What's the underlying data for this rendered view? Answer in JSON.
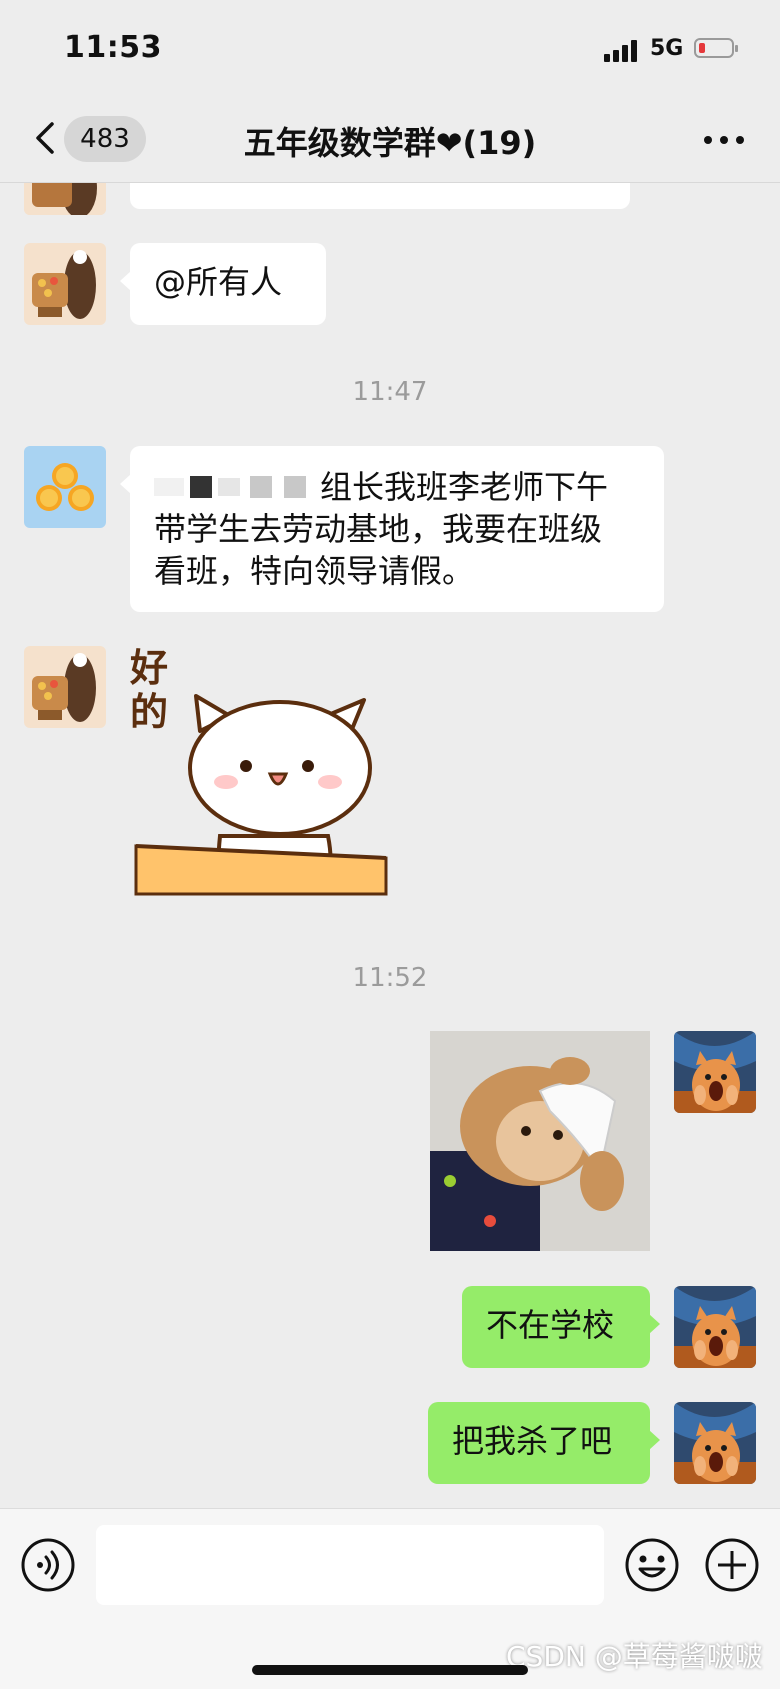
{
  "status_bar": {
    "time": "11:53",
    "network": "5G",
    "battery_level": 0.12,
    "battery_color": "#e5383b"
  },
  "header": {
    "back_icon": "chevron-left-icon",
    "unread_count": "483",
    "title": "五年级数学群❤(19)",
    "more_icon": "ellipsis-icon"
  },
  "messages": {
    "at_all": "@所有人",
    "time_1": "11:47",
    "leave_request_line_1": "组长我班李老师下午",
    "leave_request_line_2": "带学生去劳动基地，我要在班级",
    "leave_request_line_3": "看班，特向领导请假。",
    "sticker_text": "好的",
    "time_2": "11:52",
    "reply_1": "不在学校",
    "reply_2": "把我杀了吧"
  },
  "colors": {
    "background": "#ededed",
    "bubble_self": "#95ec69",
    "bubble_other": "#ffffff",
    "timestamp": "#9b9b9b"
  },
  "input_bar": {
    "voice_icon": "voice-icon",
    "emoji_icon": "emoji-icon",
    "plus_icon": "plus-circle-icon",
    "watermark": "CSDN @草莓酱啵啵"
  }
}
